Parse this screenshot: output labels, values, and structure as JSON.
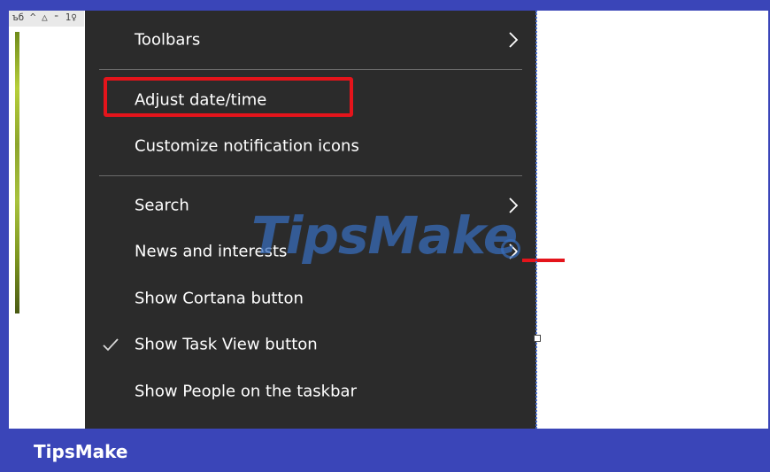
{
  "context_menu": {
    "items": [
      {
        "label": "Toolbars",
        "has_submenu": true,
        "checked": false
      },
      {
        "label": "Adjust date/time",
        "has_submenu": false,
        "checked": false,
        "highlighted": true
      },
      {
        "label": "Customize notification icons",
        "has_submenu": false,
        "checked": false
      },
      {
        "label": "Search",
        "has_submenu": true,
        "checked": false
      },
      {
        "label": "News and interests",
        "has_submenu": true,
        "checked": false
      },
      {
        "label": "Show Cortana button",
        "has_submenu": false,
        "checked": false
      },
      {
        "label": "Show Task View button",
        "has_submenu": false,
        "checked": true
      },
      {
        "label": "Show People on the taskbar",
        "has_submenu": false,
        "checked": false
      }
    ]
  },
  "left_snippet": {
    "text": "ъб ^ △ ⁼ 1♀"
  },
  "watermark": {
    "text": "TipsMake"
  },
  "footer": {
    "label": "TipsMake"
  },
  "colors": {
    "menu_bg": "#2b2b2b",
    "highlight": "#e4141b",
    "frame": "#3a45b8"
  }
}
